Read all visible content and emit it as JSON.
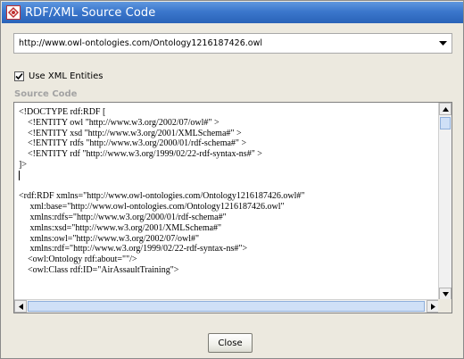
{
  "window": {
    "title": "RDF/XML Source Code",
    "icon": "rdf-logo-icon"
  },
  "ontology_combo": {
    "value": "http://www.owl-ontologies.com/Ontology1216187426.owl",
    "arrow_icon": "chevron-down-icon"
  },
  "use_xml_entities": {
    "label": "Use XML Entities",
    "checked": true
  },
  "source_code": {
    "label": "Source Code",
    "lines": [
      "<!DOCTYPE rdf:RDF [",
      "    <!ENTITY owl \"http://www.w3.org/2002/07/owl#\" >",
      "    <!ENTITY xsd \"http://www.w3.org/2001/XMLSchema#\" >",
      "    <!ENTITY rdfs \"http://www.w3.org/2000/01/rdf-schema#\" >",
      "    <!ENTITY rdf \"http://www.w3.org/1999/02/22-rdf-syntax-ns#\" >",
      "]>",
      "",
      "",
      "<rdf:RDF xmlns=\"http://www.owl-ontologies.com/Ontology1216187426.owl#\"",
      "     xml:base=\"http://www.owl-ontologies.com/Ontology1216187426.owl\"",
      "     xmlns:rdfs=\"http://www.w3.org/2000/01/rdf-schema#\"",
      "     xmlns:xsd=\"http://www.w3.org/2001/XMLSchema#\"",
      "     xmlns:owl=\"http://www.w3.org/2002/07/owl#\"",
      "     xmlns:rdf=\"http://www.w3.org/1999/02/22-rdf-syntax-ns#\">",
      "    <owl:Ontology rdf:about=\"\"/>",
      "    <owl:Class rdf:ID=\"AirAssaultTraining\">"
    ]
  },
  "buttons": {
    "close_label": "Close"
  }
}
